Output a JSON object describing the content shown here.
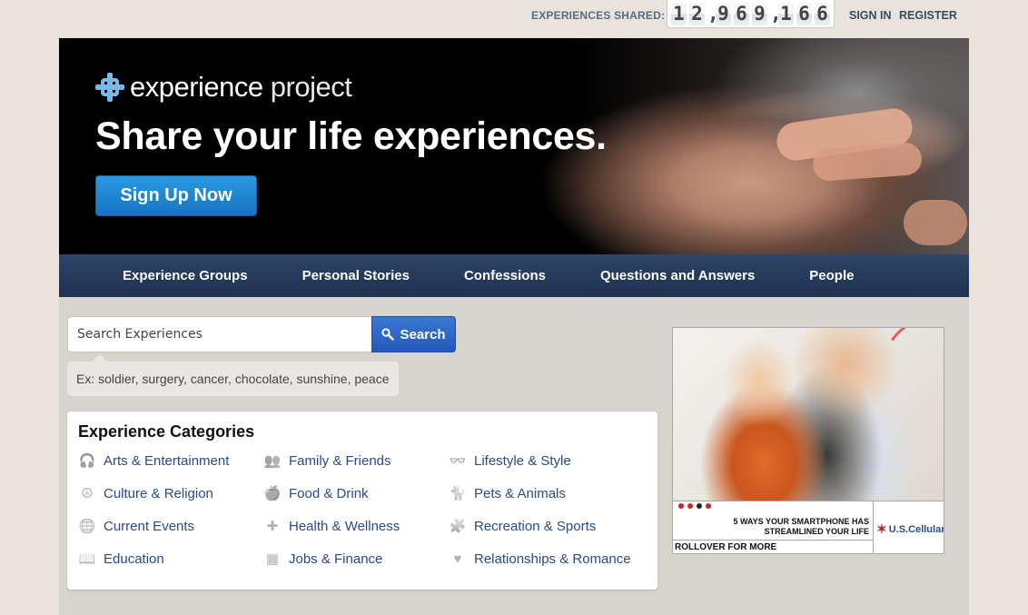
{
  "topbar": {
    "counter_label": "EXPERIENCES SHARED:",
    "counter_digits": [
      "1",
      "2",
      ",",
      "9",
      "6",
      "9",
      ",",
      "1",
      "6",
      "6"
    ],
    "signin": "SIGN IN",
    "register": "REGISTER"
  },
  "hero": {
    "logo_text_bold": "experience",
    "logo_text_light": "project",
    "headline": "Share your life experiences.",
    "signup_label": "Sign Up Now"
  },
  "nav": {
    "items": [
      "Experience Groups",
      "Personal Stories",
      "Confessions",
      "Questions and Answers",
      "People"
    ]
  },
  "search": {
    "placeholder": "Search Experiences",
    "button_label": "Search",
    "hint": "Ex: soldier, surgery, cancer, chocolate, sunshine, peace"
  },
  "categories": {
    "title": "Experience Categories",
    "items": [
      {
        "label": "Arts & Entertainment",
        "icon": "headphones-icon",
        "glyph": "🎧"
      },
      {
        "label": "Culture & Religion",
        "icon": "peace-icon",
        "glyph": "☮"
      },
      {
        "label": "Current Events",
        "icon": "globe-icon",
        "glyph": "🌐"
      },
      {
        "label": "Education",
        "icon": "book-icon",
        "glyph": "📖"
      },
      {
        "label": "Family & Friends",
        "icon": "people-icon",
        "glyph": "👥"
      },
      {
        "label": "Food & Drink",
        "icon": "apple-icon",
        "glyph": "🍎"
      },
      {
        "label": "Health & Wellness",
        "icon": "health-shield-icon",
        "glyph": "✚"
      },
      {
        "label": "Jobs & Finance",
        "icon": "calculator-icon",
        "glyph": "▦"
      },
      {
        "label": "Lifestyle & Style",
        "icon": "glasses-icon",
        "glyph": "👓"
      },
      {
        "label": "Pets & Animals",
        "icon": "cat-icon",
        "glyph": "🐈"
      },
      {
        "label": "Recreation & Sports",
        "icon": "puzzle-icon",
        "glyph": "🧩"
      },
      {
        "label": "Relationships & Romance",
        "icon": "heart-icon",
        "glyph": "♥"
      }
    ]
  },
  "ad": {
    "headline": "5 WAYS YOUR SMARTPHONE HAS STREAMLINED YOUR LIFE",
    "cta": "ROLLOVER FOR MORE",
    "brand": "U.S.Cellular"
  }
}
